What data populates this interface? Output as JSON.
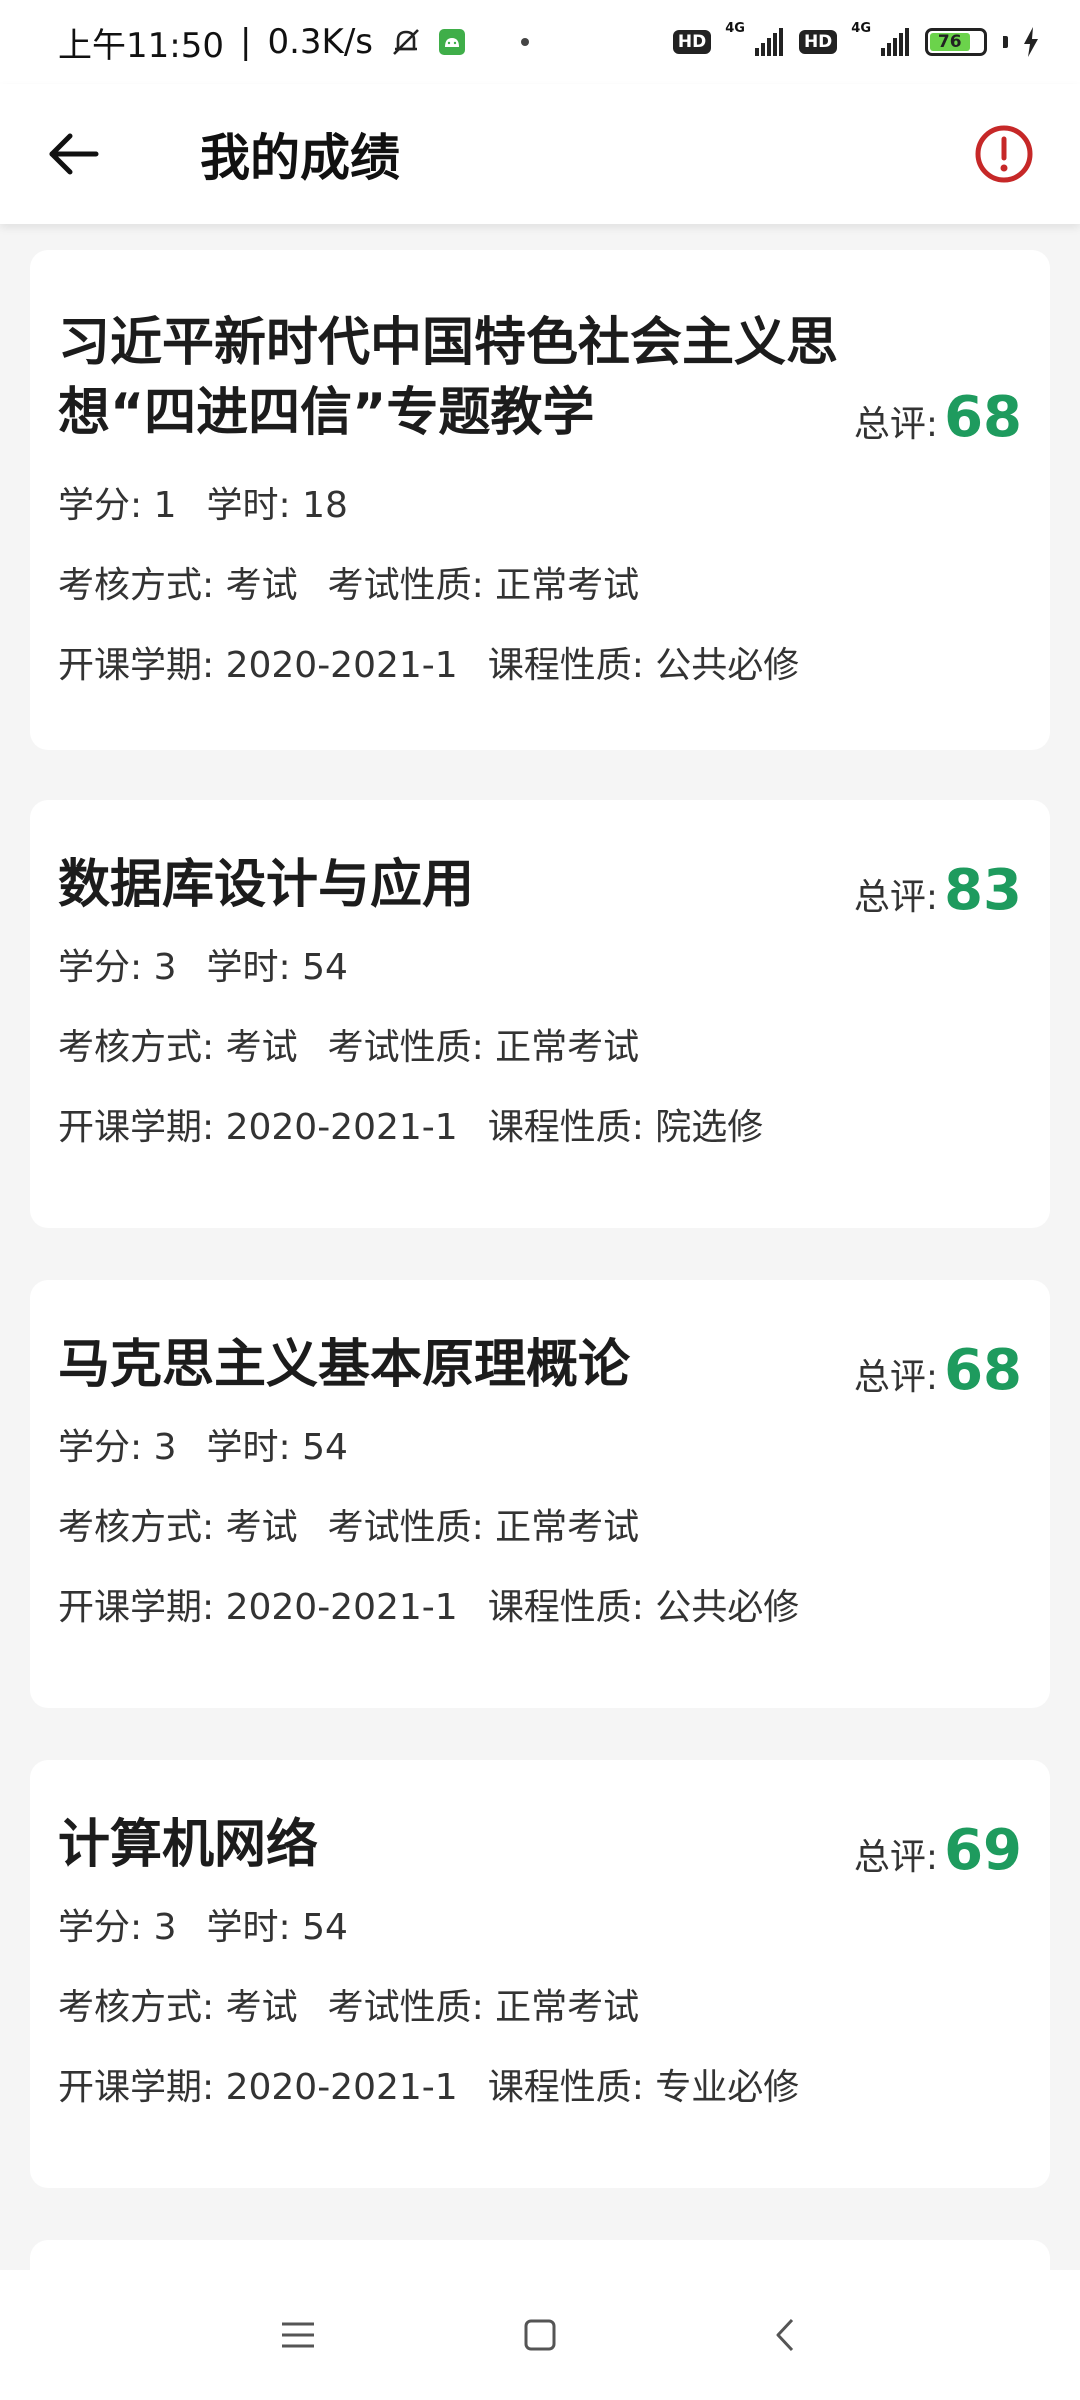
{
  "status_bar": {
    "time": "上午11:50",
    "net_speed": "0.3K/s",
    "sim1_badge": "HD",
    "sim1_net": "4G",
    "sim2_badge": "HD",
    "sim2_net": "4G",
    "battery_level": "76",
    "icons": [
      "mute-bell-icon",
      "android-icon",
      "signal-icon",
      "battery-icon",
      "charging-icon"
    ]
  },
  "header": {
    "title": "我的成绩",
    "back_icon": "arrow-left-icon",
    "alert_icon": "alert-circle-icon",
    "accent_color": "#c62828"
  },
  "labels": {
    "score": "总评: ",
    "credit": "学分: ",
    "hours": "学时: ",
    "assessment": "考核方式: ",
    "exam_type": "考试性质: ",
    "term": "开课学期: ",
    "course_type": "课程性质: "
  },
  "colors": {
    "score": "#1e9b5e",
    "background": "#f5f5f5"
  },
  "courses": [
    {
      "name": "习近平新时代中国特色社会主义思想“四进四信”专题教学",
      "score": "68",
      "credit": "1",
      "hours": "18",
      "assessment": "考试",
      "exam_type": "正常考试",
      "term": "2020-2021-1",
      "course_type": "公共必修"
    },
    {
      "name": "数据库设计与应用",
      "score": "83",
      "credit": "3",
      "hours": "54",
      "assessment": "考试",
      "exam_type": "正常考试",
      "term": "2020-2021-1",
      "course_type": "院选修"
    },
    {
      "name": "马克思主义基本原理概论",
      "score": "68",
      "credit": "3",
      "hours": "54",
      "assessment": "考试",
      "exam_type": "正常考试",
      "term": "2020-2021-1",
      "course_type": "公共必修"
    },
    {
      "name": "计算机网络",
      "score": "69",
      "credit": "3",
      "hours": "54",
      "assessment": "考试",
      "exam_type": "正常考试",
      "term": "2020-2021-1",
      "course_type": "专业必修"
    }
  ],
  "nav": {
    "icons": [
      "menu-icon",
      "home-square-icon",
      "back-chevron-icon"
    ]
  }
}
